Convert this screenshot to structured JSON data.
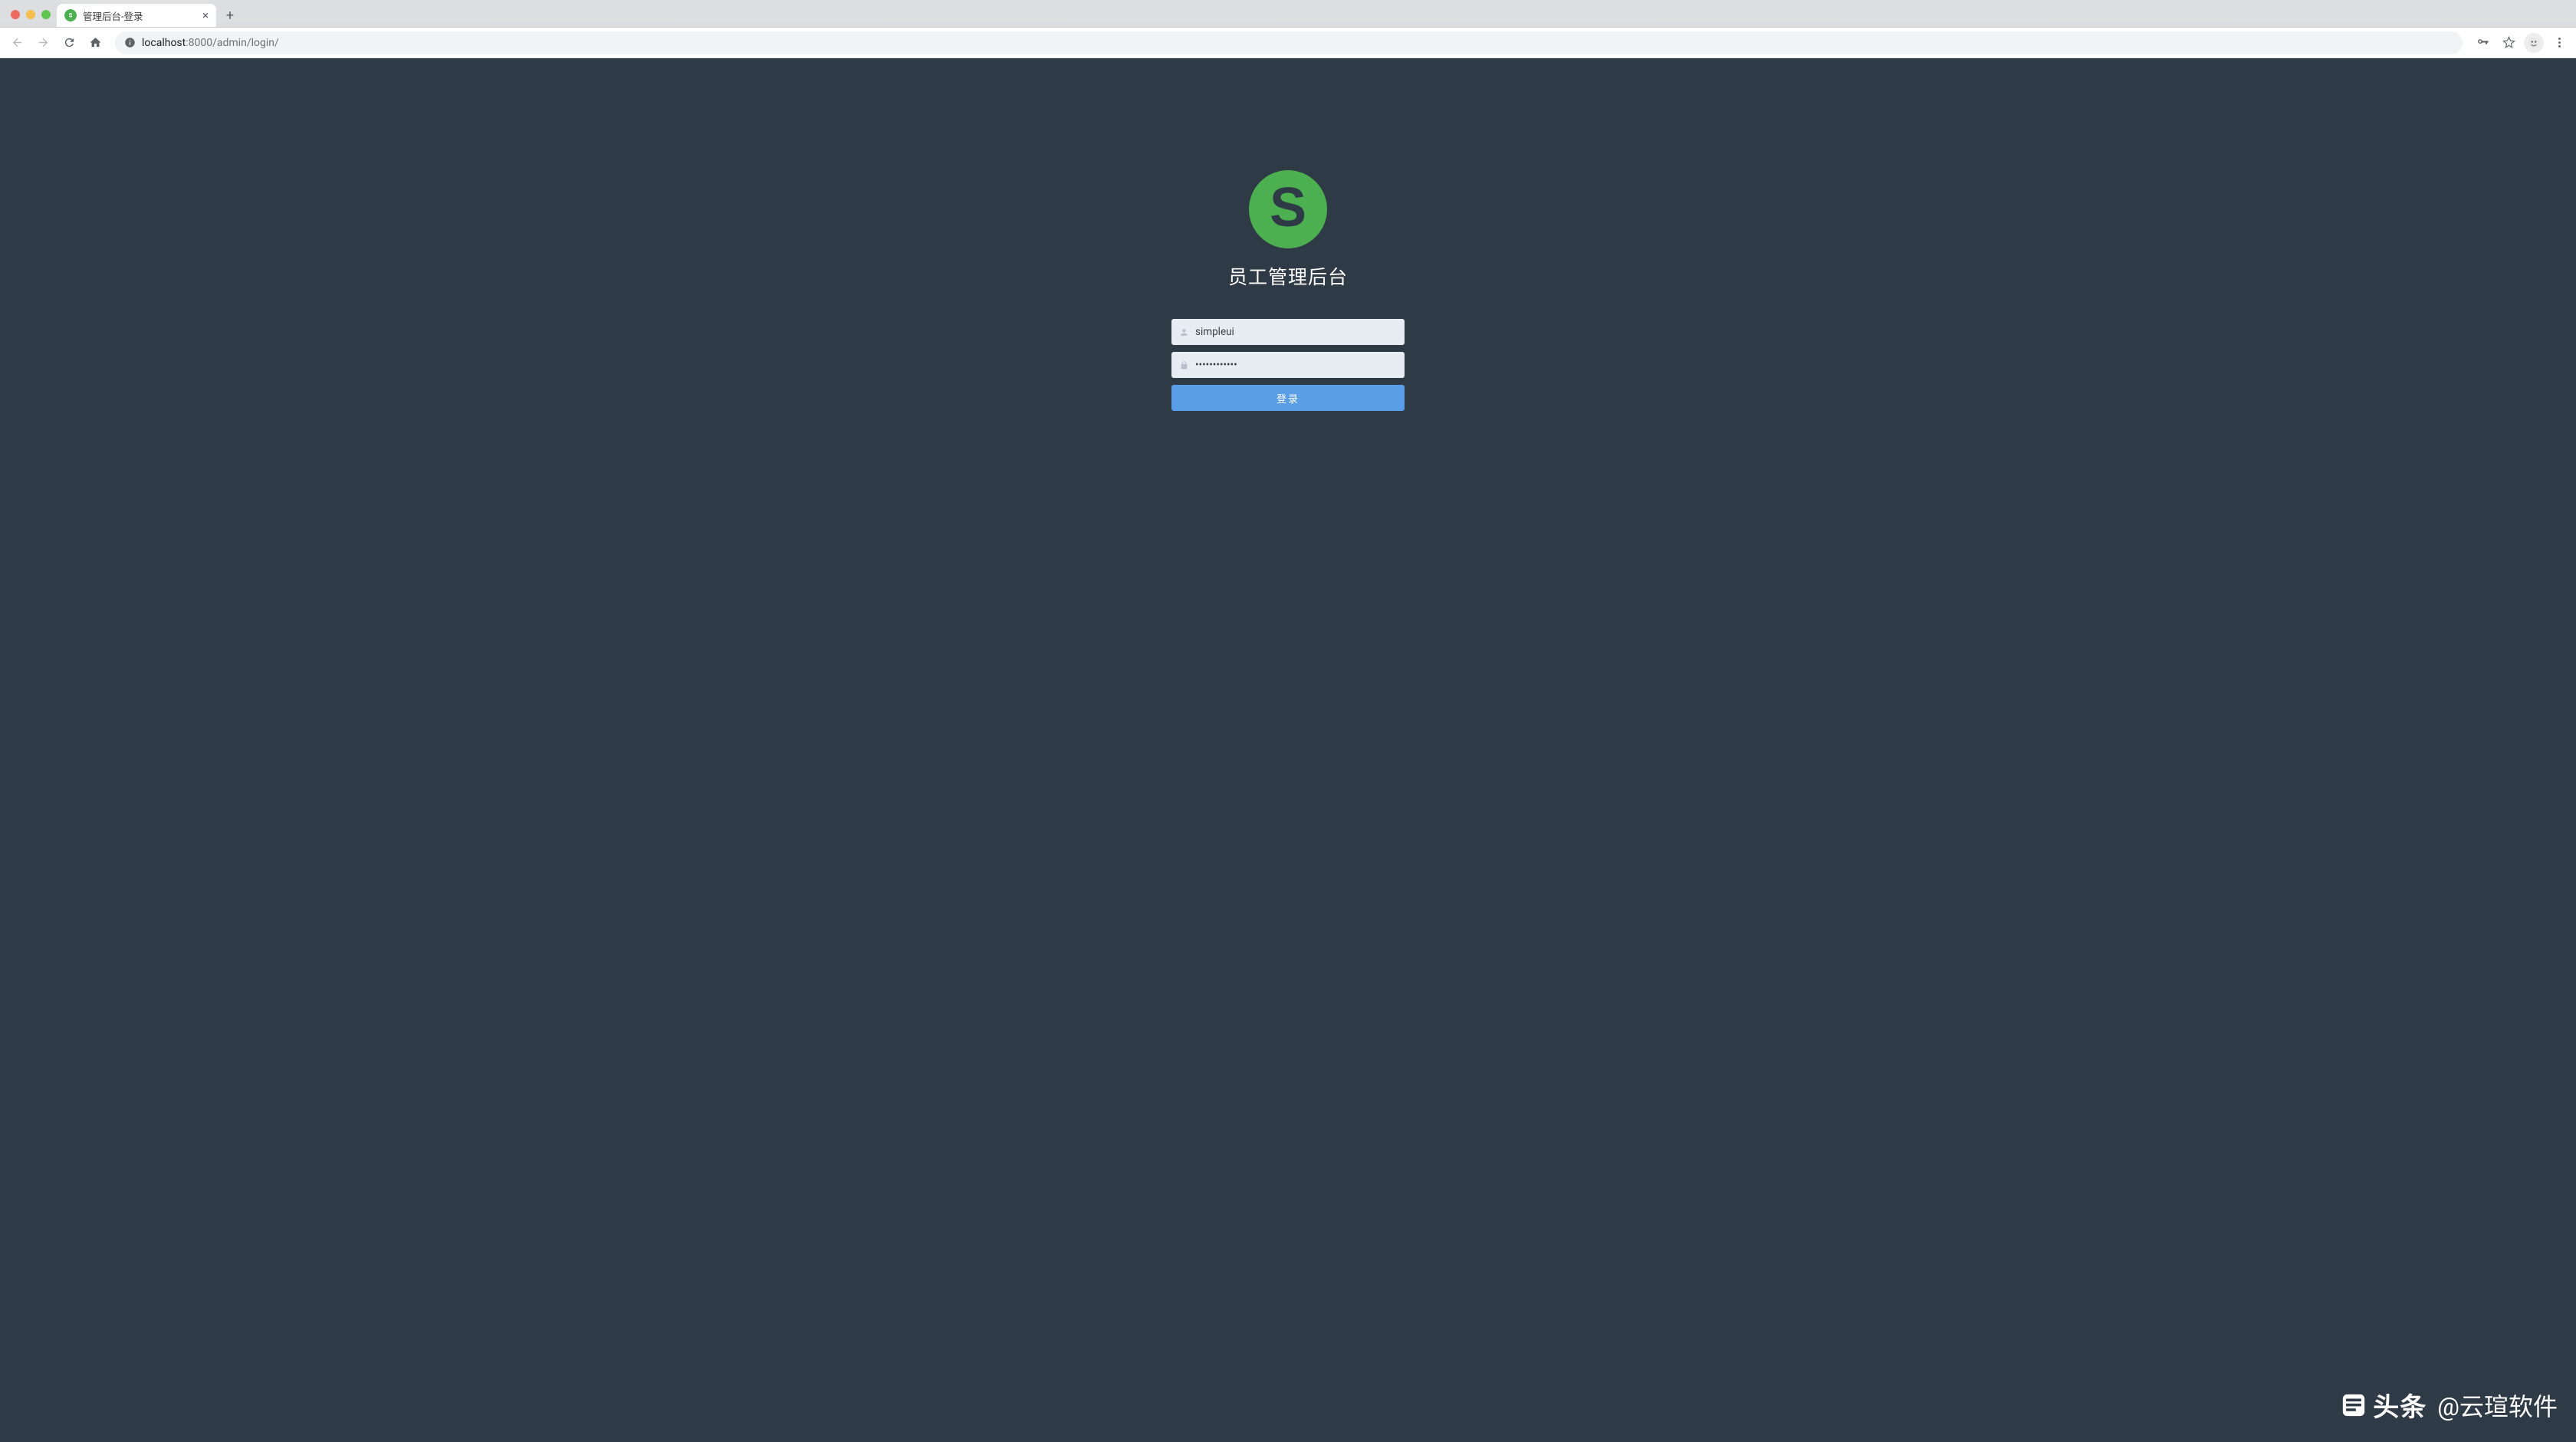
{
  "tab": {
    "title": "管理后台-登录",
    "favicon_letter": "S"
  },
  "address": {
    "host": "localhost",
    "path": ":8000/admin/login/"
  },
  "login": {
    "logo_letter": "S",
    "title": "员工管理后台",
    "username_value": "simpleui",
    "password_value": "••••••••••••",
    "submit_label": "登录"
  },
  "watermark": {
    "brand": "头条",
    "author": "@云瑄软件"
  },
  "colors": {
    "page_bg": "#2f3a47",
    "accent_green": "#4caf50",
    "button_blue": "#5a9ee8",
    "input_bg": "#e8edf3"
  }
}
